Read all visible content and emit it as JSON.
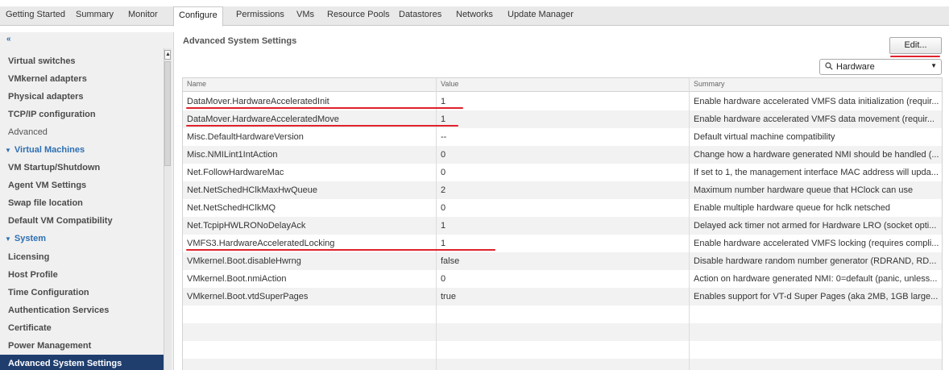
{
  "tabs": [
    {
      "label": "Getting Started",
      "active": false
    },
    {
      "label": "Summary",
      "active": false
    },
    {
      "label": "Monitor",
      "active": false
    },
    {
      "label": "Configure",
      "active": true
    },
    {
      "label": "Permissions",
      "active": false
    },
    {
      "label": "VMs",
      "active": false
    },
    {
      "label": "Resource Pools",
      "active": false
    },
    {
      "label": "Datastores",
      "active": false
    },
    {
      "label": "Networks",
      "active": false
    },
    {
      "label": "Update Manager",
      "active": false
    }
  ],
  "sidebar": {
    "collapse_glyph": "«",
    "items": [
      {
        "label": "Virtual switches"
      },
      {
        "label": "VMkernel adapters"
      },
      {
        "label": "Physical adapters"
      },
      {
        "label": "TCP/IP configuration"
      },
      {
        "label": "Advanced"
      },
      {
        "label": "Virtual Machines"
      },
      {
        "label": "VM Startup/Shutdown"
      },
      {
        "label": "Agent VM Settings"
      },
      {
        "label": "Swap file location"
      },
      {
        "label": "Default VM Compatibility"
      },
      {
        "label": "System"
      },
      {
        "label": "Licensing"
      },
      {
        "label": "Host Profile"
      },
      {
        "label": "Time Configuration"
      },
      {
        "label": "Authentication Services"
      },
      {
        "label": "Certificate"
      },
      {
        "label": "Power Management"
      },
      {
        "label": "Advanced System Settings"
      }
    ]
  },
  "main": {
    "title": "Advanced System Settings",
    "edit_label": "Edit...",
    "search_value": "Hardware",
    "columns": {
      "name": "Name",
      "value": "Value",
      "summary": "Summary"
    },
    "rows": [
      {
        "name": "DataMover.HardwareAcceleratedInit",
        "value": "1",
        "summary": "Enable hardware accelerated VMFS data initialization (requir..."
      },
      {
        "name": "DataMover.HardwareAcceleratedMove",
        "value": "1",
        "summary": "Enable hardware accelerated VMFS data movement (requir..."
      },
      {
        "name": "Misc.DefaultHardwareVersion",
        "value": "--",
        "summary": "Default virtual machine compatibility"
      },
      {
        "name": "Misc.NMILint1IntAction",
        "value": "0",
        "summary": "Change how a hardware generated NMI should be handled (..."
      },
      {
        "name": "Net.FollowHardwareMac",
        "value": "0",
        "summary": "If set to 1, the management interface MAC address will upda..."
      },
      {
        "name": "Net.NetSchedHClkMaxHwQueue",
        "value": "2",
        "summary": "Maximum number hardware queue that HClock can use"
      },
      {
        "name": "Net.NetSchedHClkMQ",
        "value": "0",
        "summary": "Enable multiple hardware queue for hclk netsched"
      },
      {
        "name": "Net.TcpipHWLRONoDelayAck",
        "value": "1",
        "summary": "Delayed ack timer not armed for Hardware LRO (socket opti..."
      },
      {
        "name": "VMFS3.HardwareAcceleratedLocking",
        "value": "1",
        "summary": "Enable hardware accelerated VMFS locking (requires compli..."
      },
      {
        "name": "VMkernel.Boot.disableHwrng",
        "value": "false",
        "summary": "Disable hardware random number generator (RDRAND, RD..."
      },
      {
        "name": "VMkernel.Boot.nmiAction",
        "value": "0",
        "summary": "Action on hardware generated NMI: 0=default (panic, unless..."
      },
      {
        "name": "VMkernel.Boot.vtdSuperPages",
        "value": "true",
        "summary": "Enables support for VT-d Super Pages (aka 2MB, 1GB large..."
      }
    ]
  },
  "colors": {
    "accent": "#1f3e6e",
    "link": "#2e6fb2",
    "annotation": "#e0212b"
  }
}
